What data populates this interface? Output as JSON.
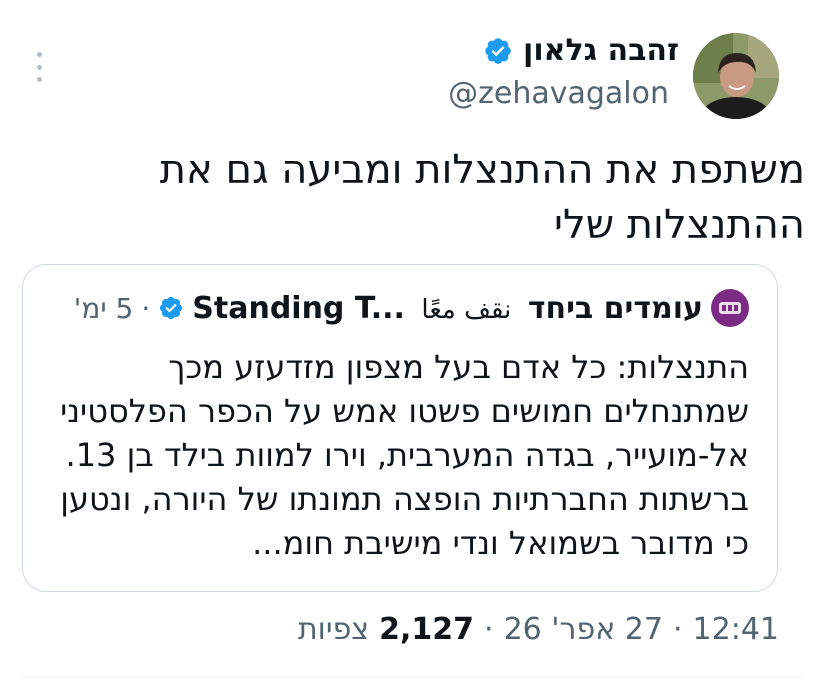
{
  "author": {
    "display_name": "זהבה גלאון",
    "handle": "@zehavagalon",
    "verified": true
  },
  "tweet": {
    "text": "משתפת את ההתנצלות ומביעה גם את ההתנצלות שלי"
  },
  "quote": {
    "name_part_a": "עומדים ביחד",
    "name_part_b": "نقف معًا",
    "name_part_c": "Standing T...",
    "time": "5 ימ'",
    "separator": "·",
    "text": "התנצלות: כל אדם בעל מצפון מזדעזע מכך שמתנחלים חמושים פשטו אמש על הכפר הפלסטיני אל-מועייר, בגדה המערבית, וירו למוות בילד בן 13. ברשתות החברתיות הופצה תמונתו של היורה, ונטען כי מדובר בשמואל ונדי מישיבת חומ..."
  },
  "meta": {
    "time": "12:41",
    "date": "27 אפר' 26",
    "views_count": "2,127",
    "views_label": "צפיות",
    "separator": "·"
  },
  "colors": {
    "text_primary": "#0f1419",
    "text_secondary": "#536471",
    "verified_blue": "#1d9bf0",
    "border": "#cfd9de",
    "quote_avatar_bg": "#7b2b83"
  },
  "icons": {
    "more": "more-vertical-icon",
    "verified": "verified-badge-icon"
  }
}
